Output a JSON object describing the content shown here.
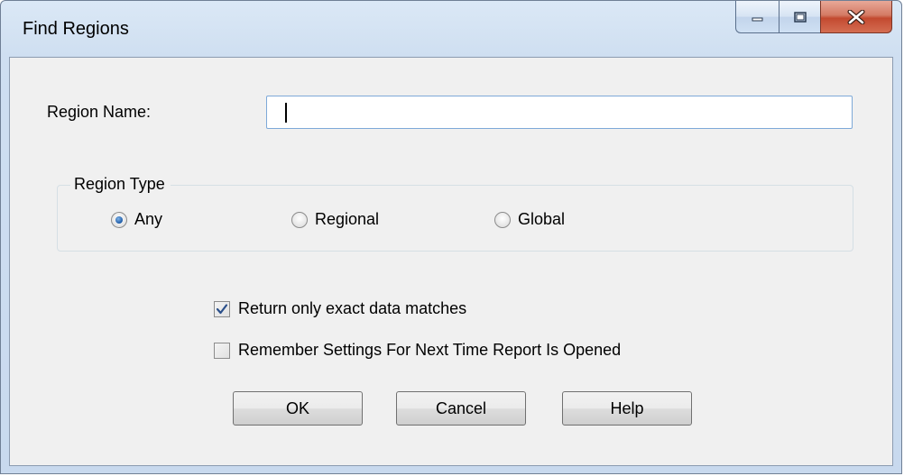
{
  "window": {
    "title": "Find Regions",
    "controls": {
      "minimize_icon": "minimize-icon",
      "maximize_icon": "maximize-icon",
      "close_icon": "close-icon"
    }
  },
  "form": {
    "region_name_label": "Region Name:",
    "region_name_value": "",
    "region_name_placeholder": ""
  },
  "region_type": {
    "legend": "Region Type",
    "options": [
      {
        "label": "Any",
        "selected": true
      },
      {
        "label": "Regional",
        "selected": false
      },
      {
        "label": "Global",
        "selected": false
      }
    ]
  },
  "options": {
    "exact_match_label": "Return only exact data matches",
    "exact_match_checked": true,
    "remember_label": "Remember Settings For Next Time Report Is Opened",
    "remember_checked": false
  },
  "buttons": {
    "ok": "OK",
    "cancel": "Cancel",
    "help": "Help"
  },
  "colors": {
    "titlebar": "#cfdff1",
    "client": "#f0f0f0",
    "close_button": "#c34a30",
    "input_border": "#7ea9d8",
    "radio_selected": "#1c5aa6"
  }
}
